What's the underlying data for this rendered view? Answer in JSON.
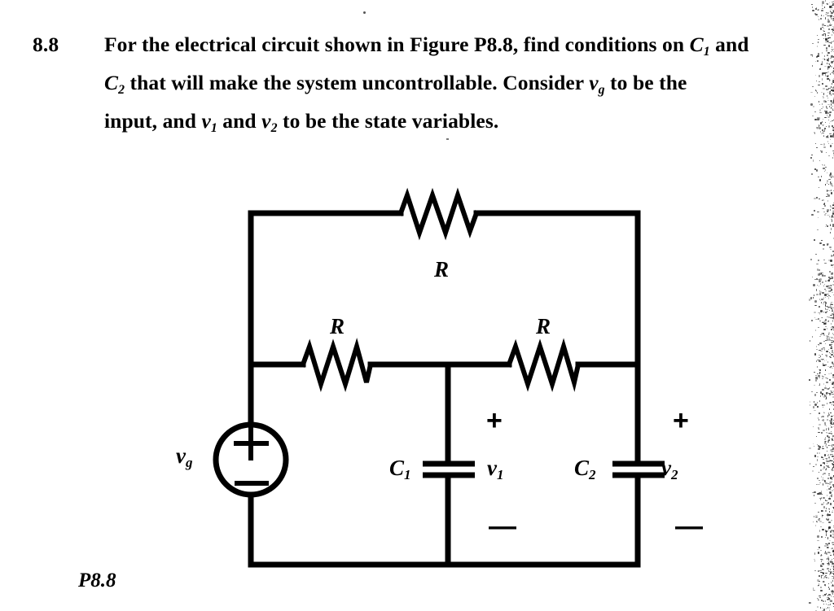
{
  "problem": {
    "number": "8.8",
    "line1_pre": "For the electrical circuit shown in Figure P8.8, find conditions on ",
    "line1_var": "C",
    "line1_sub": "1",
    "line1_post": " and",
    "line2_var": "C",
    "line2_sub": "2",
    "line2_mid": " that will make the system uncontrollable. Consider ",
    "line2_var2": "v",
    "line2_sub2": "g",
    "line2_post": " to be the",
    "line3_pre": "input, and ",
    "line3_var1": "v",
    "line3_sub1": "1",
    "line3_mid": " and ",
    "line3_var2": "v",
    "line3_sub2": "2",
    "line3_post": " to be the state variables."
  },
  "figure": {
    "caption": "P8.8",
    "components": {
      "resistor_top": "R",
      "resistor_left": "R",
      "resistor_right": "R",
      "source": "v",
      "source_sub": "g",
      "source_plus": "+",
      "source_minus": "−",
      "capacitor_1": "C",
      "capacitor_1_sub": "1",
      "capacitor_2": "C",
      "capacitor_2_sub": "2",
      "voltage_1": "v",
      "voltage_1_sub": "1",
      "voltage_2": "v",
      "voltage_2_sub": "2",
      "v1_plus": "+",
      "v1_minus": "—",
      "v2_plus": "+",
      "v2_minus": "—"
    }
  },
  "colors": {
    "ink": "#000000",
    "paper": "#ffffff"
  }
}
